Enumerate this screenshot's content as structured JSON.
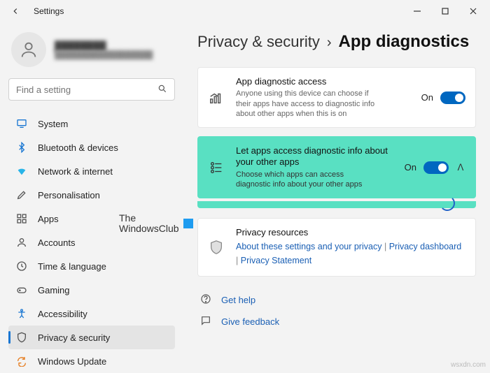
{
  "window": {
    "title": "Settings"
  },
  "profile": {
    "name": "████████",
    "email": "██████████████████"
  },
  "search": {
    "placeholder": "Find a setting"
  },
  "sidebar": {
    "items": [
      {
        "label": "System"
      },
      {
        "label": "Bluetooth & devices"
      },
      {
        "label": "Network & internet"
      },
      {
        "label": "Personalisation"
      },
      {
        "label": "Apps"
      },
      {
        "label": "Accounts"
      },
      {
        "label": "Time & language"
      },
      {
        "label": "Gaming"
      },
      {
        "label": "Accessibility"
      },
      {
        "label": "Privacy & security"
      },
      {
        "label": "Windows Update"
      }
    ]
  },
  "breadcrumb": {
    "parent": "Privacy & security",
    "sep": "›",
    "current": "App diagnostics"
  },
  "card1": {
    "title": "App diagnostic access",
    "desc": "Anyone using this device can choose if their apps have access to diagnostic info about other apps when this is on",
    "state": "On"
  },
  "card2": {
    "title": "Let apps access diagnostic info about your other apps",
    "desc": "Choose which apps can access diagnostic info about your other apps",
    "state": "On"
  },
  "card3": {
    "title": "Privacy resources",
    "link1": "About these settings and your privacy",
    "link2": "Privacy dashboard",
    "link3": "Privacy Statement"
  },
  "footer": {
    "help": "Get help",
    "feedback": "Give feedback"
  },
  "watermark": {
    "line1": "The",
    "line2": "WindowsClub"
  },
  "sitemark": "wsxdn.com"
}
